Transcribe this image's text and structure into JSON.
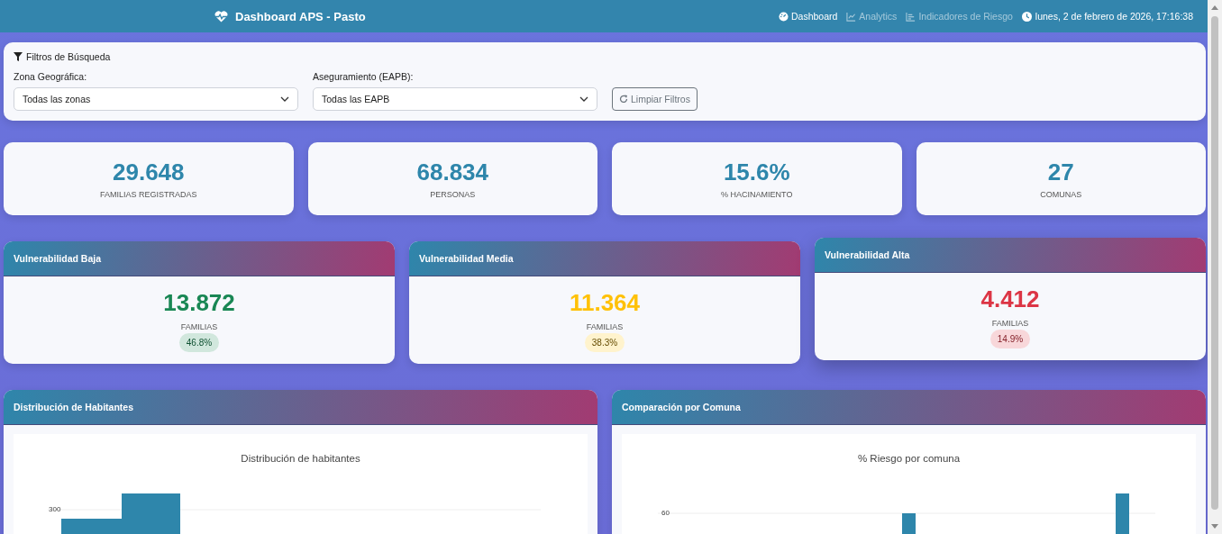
{
  "header": {
    "title": "Dashboard APS - Pasto",
    "nav": [
      {
        "label": "Dashboard",
        "selected": true
      },
      {
        "label": "Analytics",
        "selected": false
      },
      {
        "label": "Indicadores de Riesgo",
        "selected": false
      }
    ],
    "datetime": "lunes, 2 de febrero de 2026, 17:16:38"
  },
  "filters": {
    "title": "Filtros de Búsqueda",
    "fields": [
      {
        "label": "Zona Geográfica:",
        "value": "Todas las zonas"
      },
      {
        "label": "Aseguramiento (EAPB):",
        "value": "Todas las EAPB"
      }
    ],
    "clear_button": "Limpiar Filtros"
  },
  "stats": [
    {
      "value": "29.648",
      "label": "FAMILIAS REGISTRADAS"
    },
    {
      "value": "68.834",
      "label": "PERSONAS"
    },
    {
      "value": "15.6%",
      "label": "% HACINAMIENTO"
    },
    {
      "value": "27",
      "label": "COMUNAS"
    }
  ],
  "vulnerability": [
    {
      "title": "Vulnerabilidad Baja",
      "kind": "low",
      "value": "13.872",
      "label": "FAMILIAS",
      "badge": "46.8%",
      "hovered": false
    },
    {
      "title": "Vulnerabilidad Media",
      "kind": "medium",
      "value": "11.364",
      "label": "FAMILIAS",
      "badge": "38.3%",
      "hovered": false
    },
    {
      "title": "Vulnerabilidad Alta",
      "kind": "high",
      "value": "4.412",
      "label": "FAMILIAS",
      "badge": "14.9%",
      "hovered": true
    }
  ],
  "charts": [
    {
      "title": "Distribución de Habitantes",
      "kind": "histogram",
      "chart_title": "Distribución de habitantes",
      "tick": "300"
    },
    {
      "title": "Comparación por Comuna",
      "kind": "columns",
      "chart_title": "% Riesgo por comuna",
      "tick": "60"
    }
  ]
}
